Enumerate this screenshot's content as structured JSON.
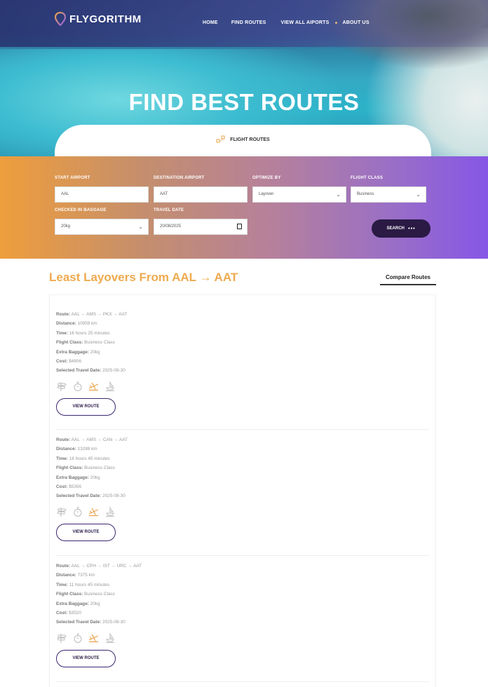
{
  "app": {
    "logo_text": "FLYGORITHM"
  },
  "nav": {
    "items": [
      "HOME",
      "FIND ROUTES",
      "VIEW ALL AIPORTS",
      "ABOUT US"
    ]
  },
  "hero": {
    "title": "FIND BEST ROUTES",
    "tab_label": "FLIGHT ROUTES"
  },
  "search": {
    "start_airport": {
      "label": "START AIRPORT",
      "value": "AAL"
    },
    "destination_airport": {
      "label": "DESTINATION AIRPORT",
      "value": "AAT"
    },
    "optimize_by": {
      "label": "OPTIMIZE BY",
      "value": "Layover"
    },
    "flight_class": {
      "label": "FLIGHT CLASS",
      "value": "Business"
    },
    "baggage": {
      "label": "CHECKED IN BAGGAGE",
      "value": "20kg"
    },
    "travel_date": {
      "label": "TRAVEL DATE",
      "value": "20/08/2025"
    },
    "search_label": "SEARCH"
  },
  "results": {
    "title": "Least Layovers From AAL → AAT",
    "compare_label": "Compare Routes",
    "view_route_label": "VIEW ROUTE",
    "field_labels": {
      "route": "Route:",
      "distance": "Distance:",
      "time": "Time:",
      "flight_class": "Flight Class:",
      "extra_baggage": "Extra Baggage:",
      "cost": "Cost:",
      "travel_date": "Selected Travel Date:"
    },
    "routes": [
      {
        "route": "AAL → AMS → PKX → AAT",
        "distance": "10959 km",
        "time": "16 hours 25 minutes",
        "flight_class": "Business Class",
        "extra_baggage": "20kg",
        "cost": "$4806",
        "travel_date": "2025-08-30"
      },
      {
        "route": "AAL → AMS → CAN → AAT",
        "distance": "13288 km",
        "time": "18 hours 45 minutes",
        "flight_class": "Business Class",
        "extra_baggage": "20kg",
        "cost": "$5356",
        "travel_date": "2025-08-30"
      },
      {
        "route": "AAL → CPH → IST → URC → AAT",
        "distance": "7375 km",
        "time": "11 hours 45 minutes",
        "flight_class": "Business Class",
        "extra_baggage": "20kg",
        "cost": "$3520",
        "travel_date": "2025-08-30"
      }
    ]
  },
  "icons": [
    "signpost-icon",
    "stopwatch-icon",
    "plane-icon",
    "ship-icon"
  ],
  "colors": {
    "accent_orange": "#efaa4e",
    "accent_purple": "#8656e6",
    "button_dark": "#2a1a44"
  }
}
